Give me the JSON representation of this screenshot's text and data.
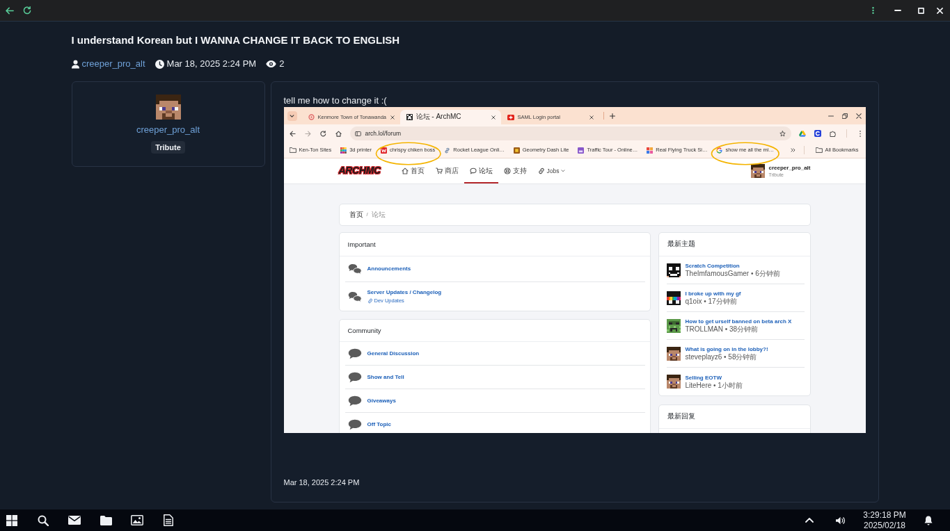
{
  "post": {
    "title": "I understand Korean but I WANNA CHANGE IT BACK TO ENGLISH",
    "author": "creeper_pro_alt",
    "date": "Mar 18, 2025 2:24 PM",
    "views": "2"
  },
  "author_card": {
    "name": "creeper_pro_alt",
    "badge": "Tribute"
  },
  "message": {
    "text": "tell me how to change it :(",
    "screenshot": {
      "tabs": [
        {
          "title": "Kenmore Town of Tonawanda",
          "selected": false
        },
        {
          "title": "论坛 - ArchMC",
          "selected": true
        },
        {
          "title": "SAML Login portal",
          "selected": false
        }
      ],
      "address": "arch.lol/forum",
      "bookmarks": [
        {
          "label": "Ken-Ton Sites",
          "circled": false
        },
        {
          "label": "3d printer",
          "circled": false
        },
        {
          "label": "chrispy chiken boss",
          "circled": true
        },
        {
          "label": "Rocket League Onli…",
          "circled": false
        },
        {
          "label": "Geometry Dash Lite",
          "circled": false
        },
        {
          "label": "Traffic Tour - Online…",
          "circled": false
        },
        {
          "label": "Real Flying Truck Si…",
          "circled": false
        },
        {
          "label": "show me all the mi…",
          "circled": true
        }
      ],
      "all_bookmarks": "All Bookmarks",
      "site": {
        "logo": "ARCHMC",
        "nav": [
          {
            "label": "首页",
            "selected": false,
            "dropdown": false
          },
          {
            "label": "商店",
            "selected": false,
            "dropdown": false
          },
          {
            "label": "论坛",
            "selected": true,
            "dropdown": false
          },
          {
            "label": "支持",
            "selected": false,
            "dropdown": false
          },
          {
            "label": "Jobs",
            "selected": false,
            "dropdown": true
          }
        ],
        "user": {
          "name": "creeper_pro_alt",
          "rank": "Tribute"
        },
        "breadcrumb": [
          {
            "label": "首页",
            "active": false
          },
          {
            "label": "论坛",
            "active": true
          }
        ],
        "breadcrumb_separator": "/",
        "categories": [
          {
            "title": "Important",
            "forums": [
              {
                "name": "Announcements"
              },
              {
                "name": "Server Updates / Changelog",
                "sublink": "Dev Updates"
              }
            ]
          },
          {
            "title": "Community",
            "forums": [
              {
                "name": "General Discussion"
              },
              {
                "name": "Show and Tell"
              },
              {
                "name": "Giveaways"
              },
              {
                "name": "Off Topic"
              }
            ]
          }
        ],
        "latest_topics": {
          "title": "最新主题",
          "items": [
            {
              "title": "Scratch Competition",
              "meta": "TheImfamousGamer • 6分钟前"
            },
            {
              "title": "I broke up with my gf",
              "meta": "q1oix • 17分钟前"
            },
            {
              "title": "How to get urself banned on beta arch X",
              "meta": "TROLLMAN • 38分钟前"
            },
            {
              "title": "What is going on in the lobby?!",
              "meta": "steveplayz6 • 58分钟前"
            },
            {
              "title": "Selling EOTW",
              "meta": "LiteHere • 1小时前"
            }
          ]
        },
        "latest_replies": {
          "title": "最新回复"
        }
      }
    },
    "date": "Mar 18, 2025 2:24 PM"
  },
  "taskbar": {
    "time": "3:29:18 PM",
    "date": "2025/02/18"
  }
}
